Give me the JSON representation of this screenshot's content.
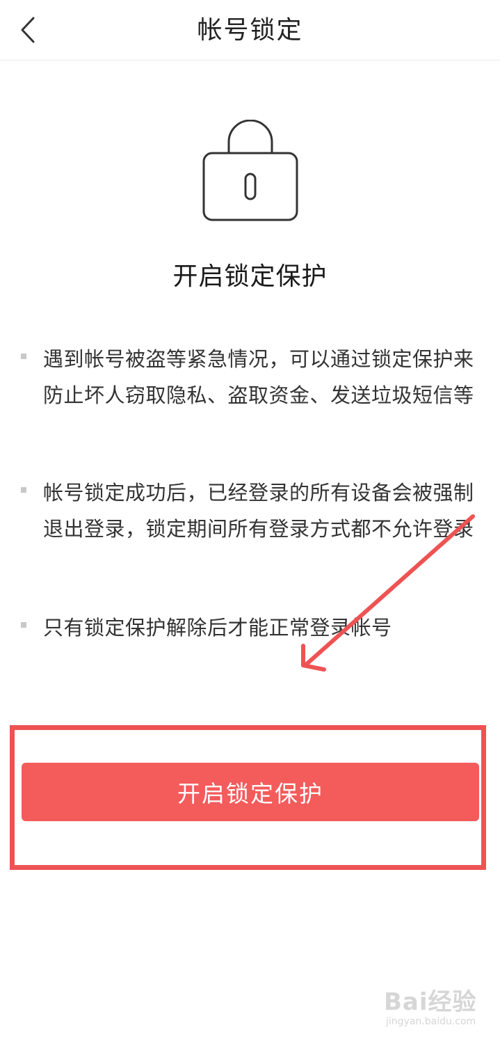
{
  "header": {
    "title": "帐号锁定"
  },
  "hero": {
    "heading": "开启锁定保护"
  },
  "bullets": [
    {
      "text": "遇到帐号被盗等紧急情况，可以通过锁定保护来防止坏人窃取隐私、盗取资金、发送垃圾短信等"
    },
    {
      "text": "帐号锁定成功后，已经登录的所有设备会被强制退出登录，锁定期间所有登录方式都不允许登录"
    },
    {
      "text": "只有锁定保护解除后才能正常登录帐号"
    }
  ],
  "actions": {
    "primary_label": "开启锁定保护"
  },
  "colors": {
    "accent": "#f45b5b",
    "annotation": "#ee5353"
  },
  "watermark": {
    "brand": "Bai经验",
    "url": "jingyan.baidu.com"
  }
}
